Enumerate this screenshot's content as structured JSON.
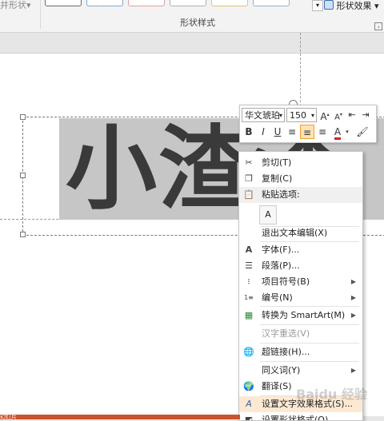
{
  "ribbon": {
    "merge_shapes": "并形状",
    "merge_arrow": "▾",
    "effects_label": "形状效果",
    "effects_arrow": "▾",
    "group_label": "形状样式",
    "launcher": "⌟"
  },
  "slide": {
    "text": "小渣渣"
  },
  "mini_toolbar": {
    "font_name": "华文琥珀",
    "font_size": "150",
    "grow_font": "A",
    "shrink_font": "A",
    "bold": "B",
    "italic": "I",
    "underline": "U",
    "font_color": "A",
    "dropdown": "▾"
  },
  "context_menu": {
    "items": [
      {
        "label": "剪切(T)",
        "icon": "scissors-icon"
      },
      {
        "label": "复制(C)",
        "icon": "copy-icon"
      },
      {
        "label": "粘贴选项:",
        "icon": "paste-icon"
      },
      {
        "label": "退出文本编辑(X)"
      },
      {
        "label": "字体(F)...",
        "icon": "font-icon"
      },
      {
        "label": "段落(P)...",
        "icon": "paragraph-icon"
      },
      {
        "label": "项目符号(B)",
        "icon": "bullets-icon"
      },
      {
        "label": "编号(N)",
        "icon": "numbering-icon"
      },
      {
        "label": "转换为 SmartArt(M)",
        "icon": "smartart-icon"
      },
      {
        "label": "汉字重选(V)"
      },
      {
        "label": "超链接(H)...",
        "icon": "hyperlink-icon"
      },
      {
        "label": "同义词(Y)"
      },
      {
        "label": "翻译(S)",
        "icon": "translate-icon"
      },
      {
        "label": "设置文字效果格式(S)...",
        "icon": "text-effects-icon"
      },
      {
        "label": "设置形状格式(O)...",
        "icon": "shape-format-icon"
      }
    ],
    "submenu_arrow": "▶"
  },
  "watermark": "Baidu 经验",
  "bottom_label": "幻灯片"
}
